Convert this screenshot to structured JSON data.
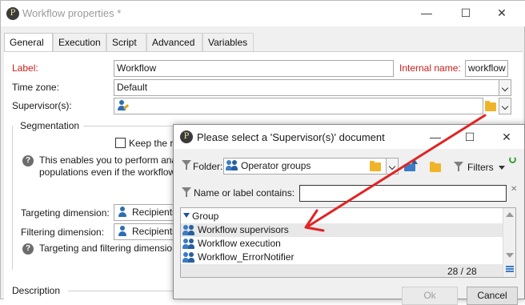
{
  "window": {
    "title": "Workflow properties *",
    "minimize": "—",
    "maximize": "☐",
    "close": "✕"
  },
  "tabs": [
    "General",
    "Execution",
    "Script",
    "Advanced",
    "Variables"
  ],
  "form": {
    "label_label": "Label:",
    "label_value": "Workflow",
    "internal_name_label": "Internal name:",
    "internal_name_value": "workflow",
    "timezone_label": "Time zone:",
    "timezone_value": "Default",
    "supervisors_label": "Supervisor(s):",
    "segmentation_label": "Segmentation",
    "keep_label": "Keep the re",
    "info_text_1": "This enables you to perform ana",
    "info_text_2": "populations even if the workflow",
    "targeting_label": "Targeting dimension:",
    "targeting_value": "Recipients",
    "filtering_label": "Filtering dimension:",
    "filtering_value": "Recipients",
    "targeting_info": "Targeting and filtering dimensio",
    "description_label": "Description"
  },
  "dialog": {
    "title": "Please select a 'Supervisor(s)' document",
    "folder_label": "Folder:",
    "folder_value": "Operator groups",
    "filters_label": "Filters",
    "name_filter_label": "Name or label contains:",
    "name_filter_value": "",
    "column_header": "Group",
    "rows": [
      "Workflow supervisors",
      "Workflow execution",
      "Workflow_ErrorNotifier"
    ],
    "count": "28 / 28",
    "ok_label": "Ok",
    "cancel_label": "Cancel"
  },
  "colors": {
    "required_label": "#c8201e",
    "annotation_arrow": "#e02424",
    "icon_blue": "#2d6db5",
    "folder_yellow": "#f0b429"
  }
}
